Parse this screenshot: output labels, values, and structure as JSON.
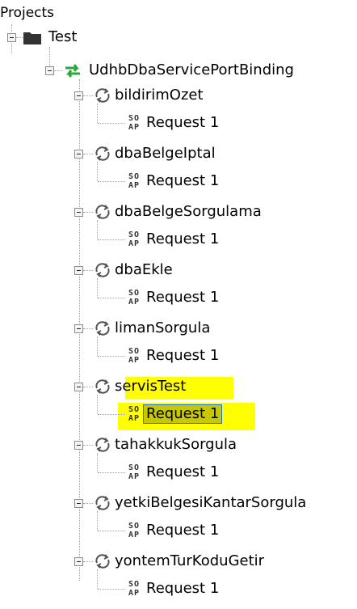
{
  "tree": {
    "root_label": "Projects",
    "project": {
      "label": "Test",
      "icon": "folder-icon"
    },
    "binding": {
      "label": "UdhbDbaServicePortBinding",
      "icon": "binding-arrows-icon"
    },
    "operations": [
      {
        "label": "bildirimOzet",
        "request": "Request 1"
      },
      {
        "label": "dbaBelgeIptal",
        "request": "Request 1"
      },
      {
        "label": "dbaBelgeSorgulama",
        "request": "Request 1"
      },
      {
        "label": "dbaEkle",
        "request": "Request 1"
      },
      {
        "label": "limanSorgula",
        "request": "Request 1"
      },
      {
        "label": "servisTest",
        "request": "Request 1",
        "highlighted": true
      },
      {
        "label": "tahakkukSorgula",
        "request": "Request 1"
      },
      {
        "label": "yetkiBelgesiKantarSorgula",
        "request": "Request 1"
      },
      {
        "label": "yontemTurKoduGetir",
        "request": "Request 1"
      }
    ],
    "soap_icon_text": [
      "SO",
      "AP"
    ],
    "colors": {
      "highlight": "#ffff00",
      "binding_green": "#2aa83a",
      "operation_icon": "#555555"
    }
  }
}
